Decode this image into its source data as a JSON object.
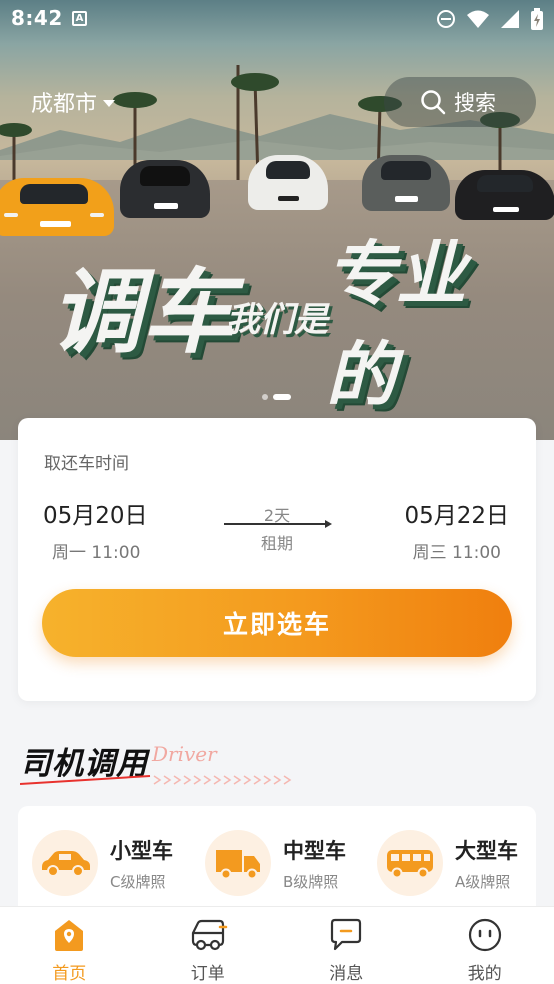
{
  "status_bar": {
    "time": "8:42",
    "notification_icon": "A"
  },
  "header": {
    "city": "成都市",
    "search_label": "搜索"
  },
  "banner": {
    "slogan_big_1": "调车",
    "slogan_small": "我们是",
    "slogan_big_2": "专业的",
    "slide_count": 2,
    "active_slide": 2
  },
  "booking": {
    "label": "取还车时间",
    "pickup_date": "05月20日",
    "pickup_time": "周一 11:00",
    "duration": "2天",
    "duration_label": "租期",
    "return_date": "05月22日",
    "return_time": "周三 11:00",
    "cta": "立即选车"
  },
  "driver_section": {
    "title": "司机调用",
    "subtitle": "Driver",
    "types": [
      {
        "name": "小型车",
        "grade": "C级牌照",
        "icon": "sedan-icon"
      },
      {
        "name": "中型车",
        "grade": "B级牌照",
        "icon": "truck-icon"
      },
      {
        "name": "大型车",
        "grade": "A级牌照",
        "icon": "bus-icon"
      }
    ]
  },
  "bottom_nav": [
    {
      "label": "首页",
      "icon": "home-icon",
      "active": true
    },
    {
      "label": "订单",
      "icon": "car-order-icon",
      "active": false
    },
    {
      "label": "消息",
      "icon": "message-icon",
      "active": false
    },
    {
      "label": "我的",
      "icon": "profile-icon",
      "active": false
    }
  ],
  "colors": {
    "accent": "#f39a1f",
    "accent_dark": "#f07f0e",
    "slogan_shadow": "#2d5a43"
  }
}
